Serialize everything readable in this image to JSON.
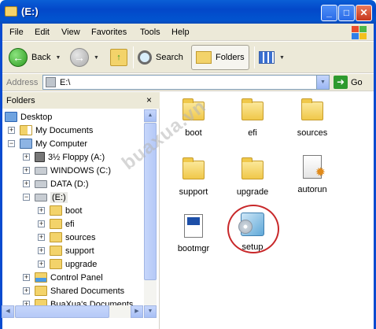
{
  "window": {
    "title": "(E:)",
    "minimize": "_",
    "maximize": "□",
    "close": "✕"
  },
  "menu": [
    "File",
    "Edit",
    "View",
    "Favorites",
    "Tools",
    "Help"
  ],
  "toolbar": {
    "back_label": "Back",
    "search_label": "Search",
    "folders_label": "Folders"
  },
  "address": {
    "label": "Address",
    "value": "E:\\",
    "go_label": "Go"
  },
  "folders_pane": {
    "title": "Folders",
    "close": "×",
    "tree": [
      {
        "label": "Desktop",
        "expander": ""
      },
      {
        "label": "My Documents",
        "expander": "+"
      },
      {
        "label": "My Computer",
        "expander": "−"
      },
      {
        "label": "3½ Floppy (A:)",
        "expander": "+"
      },
      {
        "label": "WINDOWS (C:)",
        "expander": "+"
      },
      {
        "label": "DATA (D:)",
        "expander": "+"
      },
      {
        "label": "(E:)",
        "expander": "−"
      },
      {
        "label": "boot",
        "expander": "+"
      },
      {
        "label": "efi",
        "expander": "+"
      },
      {
        "label": "sources",
        "expander": "+"
      },
      {
        "label": "support",
        "expander": "+"
      },
      {
        "label": "upgrade",
        "expander": "+"
      },
      {
        "label": "Control Panel",
        "expander": "+"
      },
      {
        "label": "Shared Documents",
        "expander": "+"
      },
      {
        "label": "BuaXua's Documents",
        "expander": "+"
      }
    ]
  },
  "content": {
    "items": [
      {
        "name": "boot",
        "icon": "folder-icon"
      },
      {
        "name": "efi",
        "icon": "folder-icon"
      },
      {
        "name": "sources",
        "icon": "folder-icon"
      },
      {
        "name": "support",
        "icon": "folder-icon"
      },
      {
        "name": "upgrade",
        "icon": "folder-icon"
      },
      {
        "name": "autorun",
        "icon": "autorun-file-icon"
      },
      {
        "name": "bootmgr",
        "icon": "system-file-icon"
      },
      {
        "name": "setup",
        "icon": "setup-app-icon"
      }
    ]
  },
  "watermark": "buaxua.vn",
  "colors": {
    "title_bar": "#0348c9",
    "highlight_ring": "#c8282a",
    "chrome": "#ece9d8"
  }
}
